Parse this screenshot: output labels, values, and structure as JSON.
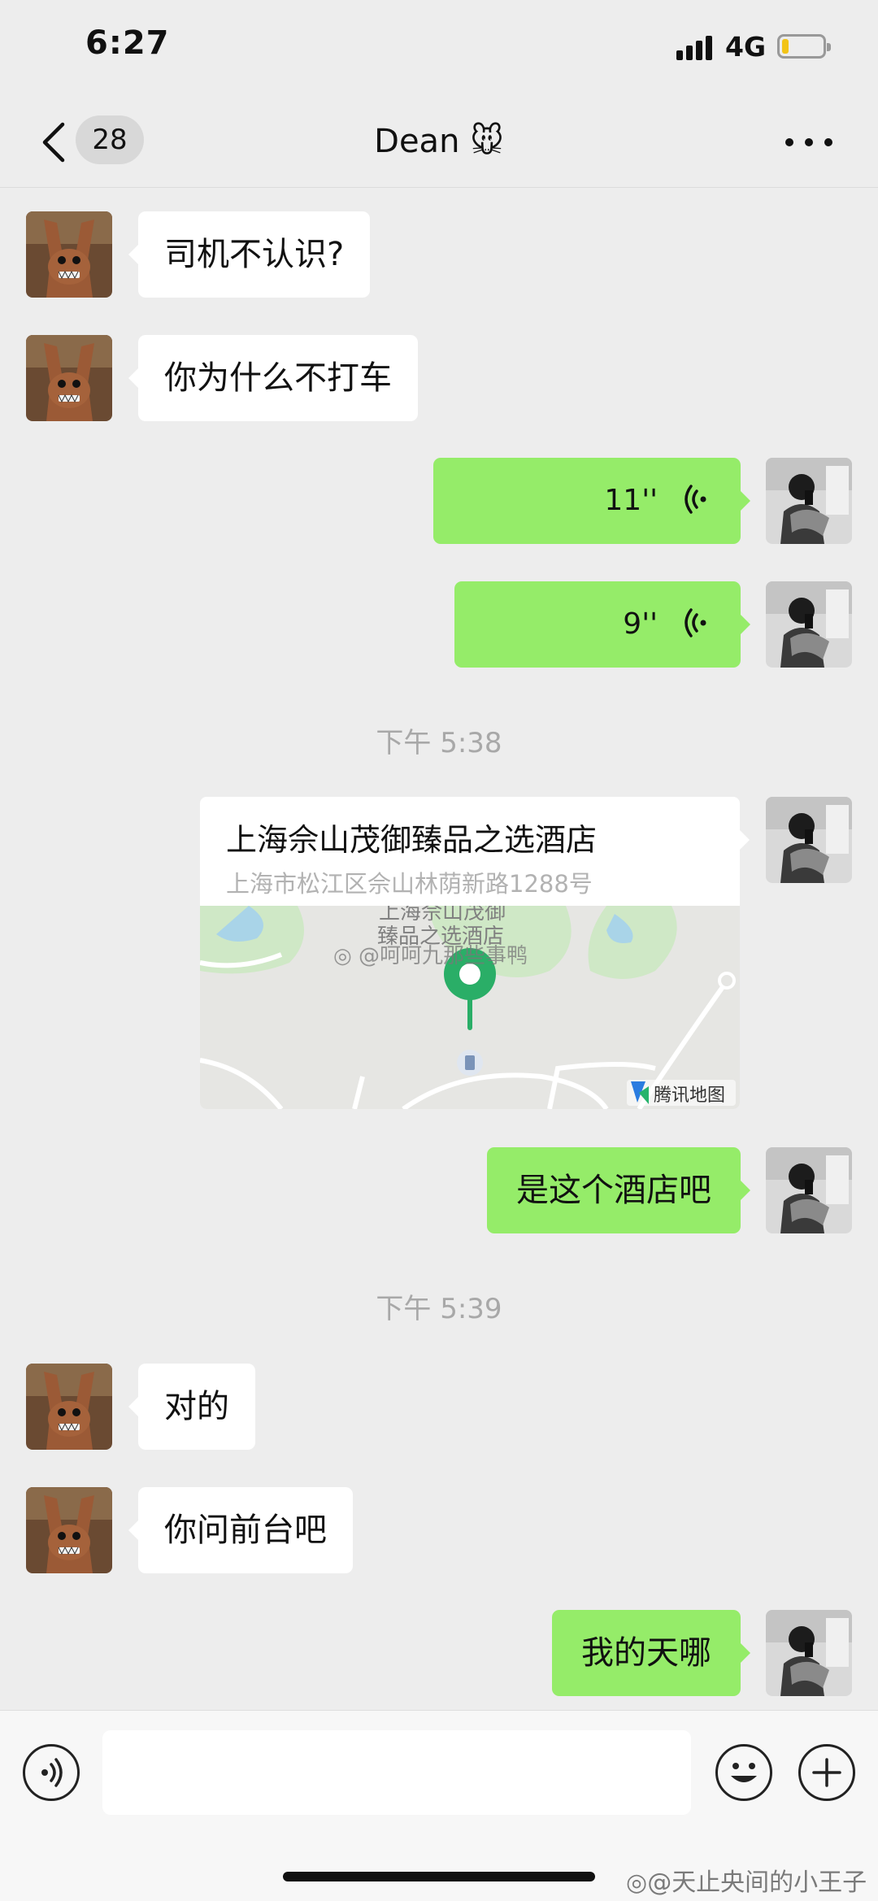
{
  "status_bar": {
    "time": "6:27",
    "network": "4G",
    "battery_level": 0.15
  },
  "nav": {
    "unread_count": "28",
    "chat_title": "Dean 🐭"
  },
  "messages": [
    {
      "from": "contact",
      "type": "text",
      "text": "司机不认识?"
    },
    {
      "from": "contact",
      "type": "text",
      "text": "你为什么不打车"
    },
    {
      "from": "me",
      "type": "voice",
      "duration": "11''"
    },
    {
      "from": "me",
      "type": "voice",
      "duration": "9''"
    },
    {
      "type": "timestamp",
      "text": "下午 5:38"
    },
    {
      "from": "me",
      "type": "location",
      "name": "上海佘山茂御臻品之选酒店",
      "address": "上海市松江区佘山林荫新路1288号",
      "map_label": "上海佘山茂御\n臻品之选酒店",
      "map_brand": "腾讯地图"
    },
    {
      "from": "me",
      "type": "text",
      "text": "是这个酒店吧"
    },
    {
      "type": "timestamp",
      "text": "下午 5:39"
    },
    {
      "from": "contact",
      "type": "text",
      "text": "对的"
    },
    {
      "from": "contact",
      "type": "text",
      "text": "你问前台吧"
    },
    {
      "from": "me",
      "type": "text",
      "text": "我的天哪"
    }
  ],
  "watermarks": {
    "map_overlay": "@呵呵九那些事鸭",
    "corner": "@天止央间的小王子"
  },
  "colors": {
    "background": "#ededed",
    "outgoing_bubble": "#95ec69",
    "incoming_bubble": "#ffffff",
    "map_pin": "#2aae67"
  },
  "icons": [
    "back-chevron-icon",
    "more-icon",
    "voice-wave-icon",
    "voice-input-icon",
    "emoji-icon",
    "plus-icon",
    "tencent-map-logo-icon",
    "weibo-icon"
  ]
}
